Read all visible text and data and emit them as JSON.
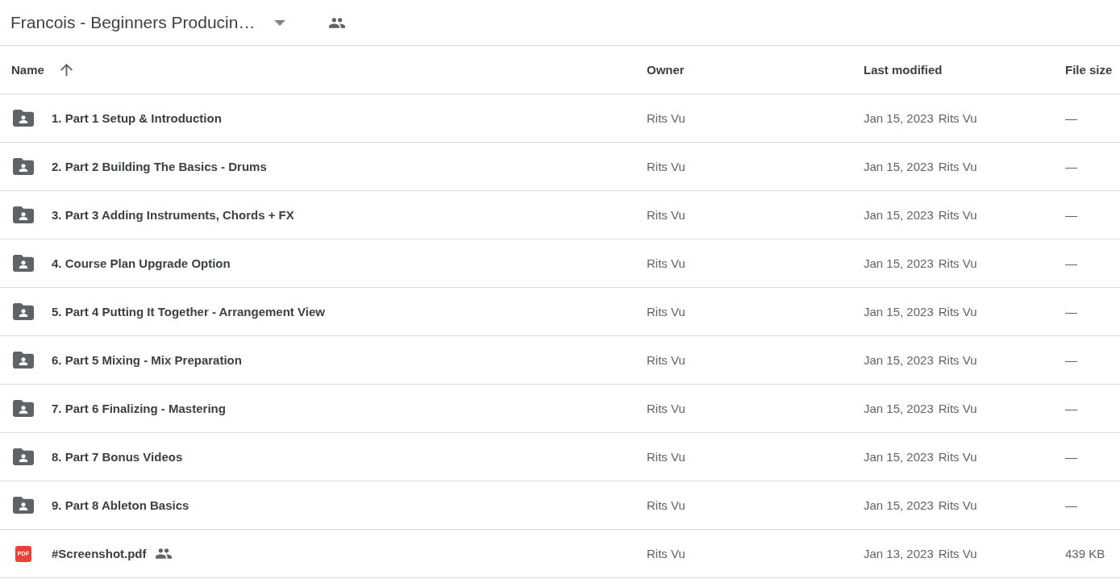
{
  "header": {
    "title": "Francois - Beginners Producin…",
    "shared": true
  },
  "table": {
    "columns": [
      {
        "label": "Name",
        "sorted": true
      },
      {
        "label": "Owner",
        "sorted": false
      },
      {
        "label": "Last modified",
        "sorted": false
      },
      {
        "label": "File size",
        "sorted": false
      }
    ],
    "rows": [
      {
        "kind": "folder",
        "name": "1. Part 1 Setup & Introduction",
        "shared": false,
        "owner": "Rits Vu",
        "modified": "Jan 15, 2023",
        "modified_by": "Rits Vu",
        "size": "—"
      },
      {
        "kind": "folder",
        "name": "2. Part 2 Building The Basics - Drums",
        "shared": false,
        "owner": "Rits Vu",
        "modified": "Jan 15, 2023",
        "modified_by": "Rits Vu",
        "size": "—"
      },
      {
        "kind": "folder",
        "name": "3. Part 3 Adding Instruments, Chords + FX",
        "shared": false,
        "owner": "Rits Vu",
        "modified": "Jan 15, 2023",
        "modified_by": "Rits Vu",
        "size": "—"
      },
      {
        "kind": "folder",
        "name": "4. Course Plan Upgrade Option",
        "shared": false,
        "owner": "Rits Vu",
        "modified": "Jan 15, 2023",
        "modified_by": "Rits Vu",
        "size": "—"
      },
      {
        "kind": "folder",
        "name": "5. Part 4 Putting It Together - Arrangement View",
        "shared": false,
        "owner": "Rits Vu",
        "modified": "Jan 15, 2023",
        "modified_by": "Rits Vu",
        "size": "—"
      },
      {
        "kind": "folder",
        "name": "6. Part 5 Mixing - Mix Preparation",
        "shared": false,
        "owner": "Rits Vu",
        "modified": "Jan 15, 2023",
        "modified_by": "Rits Vu",
        "size": "—"
      },
      {
        "kind": "folder",
        "name": "7. Part 6 Finalizing - Mastering",
        "shared": false,
        "owner": "Rits Vu",
        "modified": "Jan 15, 2023",
        "modified_by": "Rits Vu",
        "size": "—"
      },
      {
        "kind": "folder",
        "name": "8. Part 7 Bonus Videos",
        "shared": false,
        "owner": "Rits Vu",
        "modified": "Jan 15, 2023",
        "modified_by": "Rits Vu",
        "size": "—"
      },
      {
        "kind": "folder",
        "name": "9. Part 8 Ableton Basics",
        "shared": false,
        "owner": "Rits Vu",
        "modified": "Jan 15, 2023",
        "modified_by": "Rits Vu",
        "size": "—"
      },
      {
        "kind": "pdf",
        "icon_text": "PDF",
        "name": "#Screenshot.pdf",
        "shared": true,
        "owner": "Rits Vu",
        "modified": "Jan 13, 2023",
        "modified_by": "Rits Vu",
        "size": "439 KB"
      }
    ]
  }
}
